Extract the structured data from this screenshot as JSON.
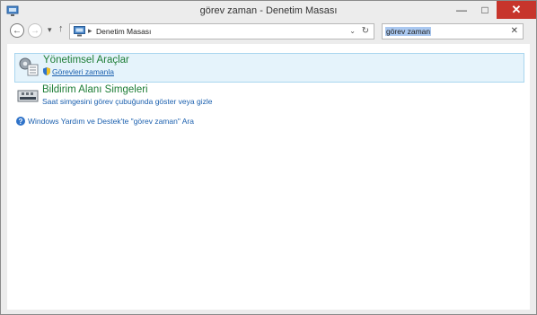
{
  "window": {
    "title": "görev zaman - Denetim Masası",
    "controls": {
      "minimize": "—",
      "maximize": "□",
      "close": "✕"
    }
  },
  "nav": {
    "back_glyph": "←",
    "forward_glyph": "→",
    "recent_glyph": "▾",
    "up_glyph": "↑",
    "breadcrumb_sep": "▸",
    "address": "Denetim Masası",
    "address_dropdown_glyph": "⌄",
    "refresh_glyph": "↻"
  },
  "search": {
    "value": "görev zaman",
    "clear_glyph": "✕"
  },
  "results": [
    {
      "title": "Yönetimsel Araçlar",
      "subtitle": "Görevleri zamanla",
      "icon": "admin-tools-icon",
      "selected": true
    },
    {
      "title": "Bildirim Alanı Simgeleri",
      "subtitle": "Saat simgesini görev çubuğunda göster veya gizle",
      "icon": "notification-area-icon",
      "selected": false
    }
  ],
  "help": {
    "icon": "help-icon",
    "glyph": "?",
    "text": "Windows Yardım ve Destek'te \"görev zaman\" Ara"
  },
  "colors": {
    "title_green": "#1e7d36",
    "link_blue": "#1a5fae",
    "selection_bg": "#e5f3fb",
    "close_red": "#c7352c"
  }
}
